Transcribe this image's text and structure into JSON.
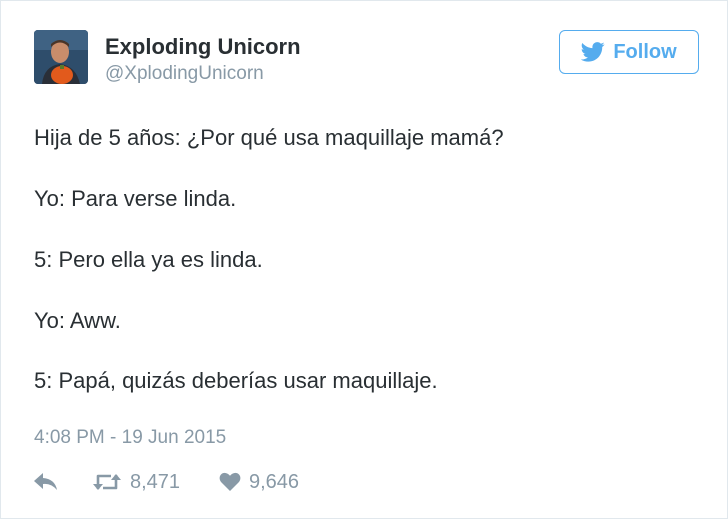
{
  "user": {
    "name": "Exploding Unicorn",
    "handle": "@XplodingUnicorn"
  },
  "follow_button": {
    "label": "Follow",
    "icon": "twitter-bird-icon"
  },
  "tweet": {
    "lines": [
      "Hija de 5 años: ¿Por qué usa maquillaje mamá?",
      "Yo: Para verse linda.",
      "5: Pero ella ya es linda.",
      "Yo: Aww.",
      "5: Papá, quizás deberías usar maquillaje."
    ],
    "timestamp": "4:08 PM - 19 Jun 2015"
  },
  "actions": {
    "reply_icon": "reply-arrow-icon",
    "retweet_icon": "retweet-icon",
    "retweet_count": "8,471",
    "like_icon": "heart-icon",
    "like_count": "9,646"
  },
  "colors": {
    "accent": "#55acee",
    "text": "#292f33",
    "muted": "#8899a6",
    "border": "#e1e8ed"
  }
}
